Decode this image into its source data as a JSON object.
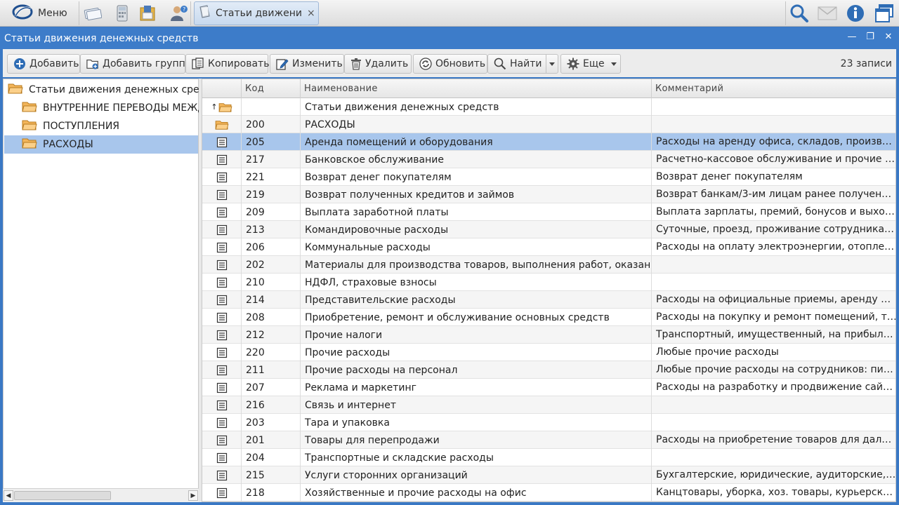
{
  "topbar": {
    "menu_label": "Меню",
    "tab_label": "Статьи движения...",
    "tab_close": "×"
  },
  "window": {
    "title": "Статьи движения денежных средств",
    "minimize": "—",
    "restore": "❐",
    "close": "✕"
  },
  "toolbar": {
    "add": "Добавить",
    "add_group": "Добавить группу",
    "copy": "Копировать",
    "edit": "Изменить",
    "delete": "Удалить",
    "refresh": "Обновить",
    "find": "Найти",
    "more": "Еще",
    "records": "23 записи"
  },
  "tree": {
    "root": "Статьи движения денежных средств",
    "items": [
      "ВНУТРЕННИЕ ПЕРЕВОДЫ МЕЖДУ",
      "ПОСТУПЛЕНИЯ",
      "РАСХОДЫ"
    ],
    "selected": "РАСХОДЫ"
  },
  "grid": {
    "columns": [
      "Код",
      "Наименование",
      "Комментарий"
    ],
    "up_row": {
      "code": "",
      "name": "Статьи движения денежных средств",
      "comment": ""
    },
    "group_row": {
      "code": "200",
      "name": "РАСХОДЫ",
      "comment": ""
    },
    "rows": [
      {
        "code": "205",
        "name": "Аренда помещений и оборудования",
        "comment": "Расходы на аренду офиса, складов, производств...",
        "selected": true
      },
      {
        "code": "217",
        "name": "Банковское обслуживание",
        "comment": "Расчетно-кассовое обслуживание и прочие услу..."
      },
      {
        "code": "221",
        "name": "Возврат денег покупателям",
        "comment": "Возврат денег покупателям"
      },
      {
        "code": "219",
        "name": "Возврат полученных кредитов и займов",
        "comment": "Возврат банкам/3-им лицам ранее полученных ..."
      },
      {
        "code": "209",
        "name": "Выплата заработной платы",
        "comment": "Выплата зарплаты, премий, бонусов и выходных..."
      },
      {
        "code": "213",
        "name": "Командировочные расходы",
        "comment": "Суточные, проезд, проживание сотрудника в ко..."
      },
      {
        "code": "206",
        "name": "Коммунальные расходы",
        "comment": "Расходы на оплату электроэнергии, отопления, в..."
      },
      {
        "code": "202",
        "name": "Материалы для производства товаров, выполнения работ, оказания услуг",
        "comment": ""
      },
      {
        "code": "210",
        "name": "НДФЛ, страховые взносы",
        "comment": ""
      },
      {
        "code": "214",
        "name": "Представительские расходы",
        "comment": "Расходы на официальные приемы, аренду поме..."
      },
      {
        "code": "208",
        "name": "Приобретение, ремонт и обслуживание основных средств",
        "comment": "Расходы на покупку и ремонт помещений, транс..."
      },
      {
        "code": "212",
        "name": "Прочие налоги",
        "comment": "Транспортный, имущественный, на прибыль, НД..."
      },
      {
        "code": "220",
        "name": "Прочие расходы",
        "comment": "Любые прочие расходы"
      },
      {
        "code": "211",
        "name": "Прочие расходы на персонал",
        "comment": "Любые прочие расходы на сотрудников: питание..."
      },
      {
        "code": "207",
        "name": "Реклама и маркетинг",
        "comment": "Расходы на разработку и продвижение сайта, ра..."
      },
      {
        "code": "216",
        "name": "Связь и интернет",
        "comment": ""
      },
      {
        "code": "203",
        "name": "Тара и упаковка",
        "comment": ""
      },
      {
        "code": "201",
        "name": "Товары для перепродажи",
        "comment": "Расходы на приобретение товаров для дальней..."
      },
      {
        "code": "204",
        "name": "Транспортные и складские расходы",
        "comment": ""
      },
      {
        "code": "215",
        "name": "Услуги сторонних организаций",
        "comment": "Бухгалтерские, юридические, аудиторские, нота..."
      },
      {
        "code": "218",
        "name": "Хозяйственные и прочие расходы на офис",
        "comment": "Канцтовары, уборка, хоз. товары, курьерские и п..."
      }
    ]
  },
  "colors": {
    "accent": "#3d7cc9",
    "selection": "#a8c6ec",
    "folder": "#f3b55a"
  }
}
